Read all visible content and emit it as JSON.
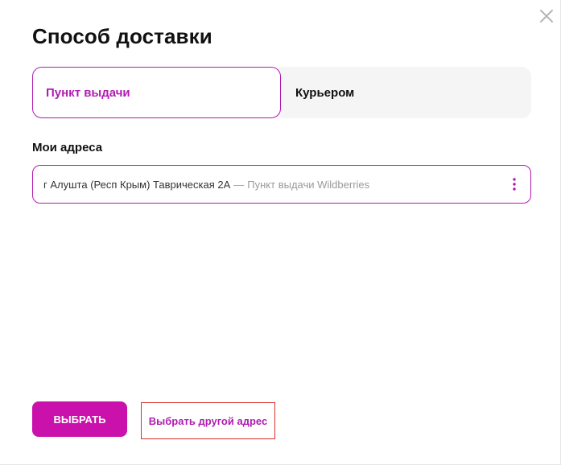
{
  "dialog": {
    "title": "Способ доставки",
    "close_icon": "close-icon"
  },
  "tabs": [
    {
      "label": "Пункт выдачи",
      "selected": true
    },
    {
      "label": "Курьером",
      "selected": false
    }
  ],
  "addresses": {
    "section_label": "Мои адреса",
    "items": [
      {
        "address": "г Алушта (Респ Крым) Таврическая 2А",
        "separator": "—",
        "type": "Пункт выдачи Wildberries",
        "menu_icon": "more-vertical-icon"
      }
    ]
  },
  "actions": {
    "select_label": "Выбрать",
    "other_address_label": "Выбрать другой адрес"
  },
  "colors": {
    "accent": "#cb11ab",
    "accent_text": "#b01cb0",
    "inactive_tab_bg": "#f5f5f6",
    "muted_text": "#9a9a9a",
    "focus_outline": "#d93030"
  }
}
